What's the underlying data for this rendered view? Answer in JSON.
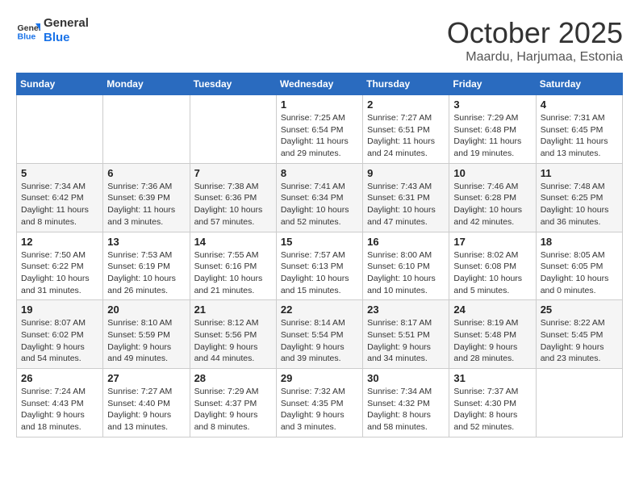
{
  "logo": {
    "line1": "General",
    "line2": "Blue"
  },
  "title": "October 2025",
  "location": "Maardu, Harjumaa, Estonia",
  "weekdays": [
    "Sunday",
    "Monday",
    "Tuesday",
    "Wednesday",
    "Thursday",
    "Friday",
    "Saturday"
  ],
  "weeks": [
    [
      null,
      null,
      null,
      {
        "day": 1,
        "sunrise": "7:25 AM",
        "sunset": "6:54 PM",
        "daylight": "11 hours and 29 minutes."
      },
      {
        "day": 2,
        "sunrise": "7:27 AM",
        "sunset": "6:51 PM",
        "daylight": "11 hours and 24 minutes."
      },
      {
        "day": 3,
        "sunrise": "7:29 AM",
        "sunset": "6:48 PM",
        "daylight": "11 hours and 19 minutes."
      },
      {
        "day": 4,
        "sunrise": "7:31 AM",
        "sunset": "6:45 PM",
        "daylight": "11 hours and 13 minutes."
      }
    ],
    [
      {
        "day": 5,
        "sunrise": "7:34 AM",
        "sunset": "6:42 PM",
        "daylight": "11 hours and 8 minutes."
      },
      {
        "day": 6,
        "sunrise": "7:36 AM",
        "sunset": "6:39 PM",
        "daylight": "11 hours and 3 minutes."
      },
      {
        "day": 7,
        "sunrise": "7:38 AM",
        "sunset": "6:36 PM",
        "daylight": "10 hours and 57 minutes."
      },
      {
        "day": 8,
        "sunrise": "7:41 AM",
        "sunset": "6:34 PM",
        "daylight": "10 hours and 52 minutes."
      },
      {
        "day": 9,
        "sunrise": "7:43 AM",
        "sunset": "6:31 PM",
        "daylight": "10 hours and 47 minutes."
      },
      {
        "day": 10,
        "sunrise": "7:46 AM",
        "sunset": "6:28 PM",
        "daylight": "10 hours and 42 minutes."
      },
      {
        "day": 11,
        "sunrise": "7:48 AM",
        "sunset": "6:25 PM",
        "daylight": "10 hours and 36 minutes."
      }
    ],
    [
      {
        "day": 12,
        "sunrise": "7:50 AM",
        "sunset": "6:22 PM",
        "daylight": "10 hours and 31 minutes."
      },
      {
        "day": 13,
        "sunrise": "7:53 AM",
        "sunset": "6:19 PM",
        "daylight": "10 hours and 26 minutes."
      },
      {
        "day": 14,
        "sunrise": "7:55 AM",
        "sunset": "6:16 PM",
        "daylight": "10 hours and 21 minutes."
      },
      {
        "day": 15,
        "sunrise": "7:57 AM",
        "sunset": "6:13 PM",
        "daylight": "10 hours and 15 minutes."
      },
      {
        "day": 16,
        "sunrise": "8:00 AM",
        "sunset": "6:10 PM",
        "daylight": "10 hours and 10 minutes."
      },
      {
        "day": 17,
        "sunrise": "8:02 AM",
        "sunset": "6:08 PM",
        "daylight": "10 hours and 5 minutes."
      },
      {
        "day": 18,
        "sunrise": "8:05 AM",
        "sunset": "6:05 PM",
        "daylight": "10 hours and 0 minutes."
      }
    ],
    [
      {
        "day": 19,
        "sunrise": "8:07 AM",
        "sunset": "6:02 PM",
        "daylight": "9 hours and 54 minutes."
      },
      {
        "day": 20,
        "sunrise": "8:10 AM",
        "sunset": "5:59 PM",
        "daylight": "9 hours and 49 minutes."
      },
      {
        "day": 21,
        "sunrise": "8:12 AM",
        "sunset": "5:56 PM",
        "daylight": "9 hours and 44 minutes."
      },
      {
        "day": 22,
        "sunrise": "8:14 AM",
        "sunset": "5:54 PM",
        "daylight": "9 hours and 39 minutes."
      },
      {
        "day": 23,
        "sunrise": "8:17 AM",
        "sunset": "5:51 PM",
        "daylight": "9 hours and 34 minutes."
      },
      {
        "day": 24,
        "sunrise": "8:19 AM",
        "sunset": "5:48 PM",
        "daylight": "9 hours and 28 minutes."
      },
      {
        "day": 25,
        "sunrise": "8:22 AM",
        "sunset": "5:45 PM",
        "daylight": "9 hours and 23 minutes."
      }
    ],
    [
      {
        "day": 26,
        "sunrise": "7:24 AM",
        "sunset": "4:43 PM",
        "daylight": "9 hours and 18 minutes."
      },
      {
        "day": 27,
        "sunrise": "7:27 AM",
        "sunset": "4:40 PM",
        "daylight": "9 hours and 13 minutes."
      },
      {
        "day": 28,
        "sunrise": "7:29 AM",
        "sunset": "4:37 PM",
        "daylight": "9 hours and 8 minutes."
      },
      {
        "day": 29,
        "sunrise": "7:32 AM",
        "sunset": "4:35 PM",
        "daylight": "9 hours and 3 minutes."
      },
      {
        "day": 30,
        "sunrise": "7:34 AM",
        "sunset": "4:32 PM",
        "daylight": "8 hours and 58 minutes."
      },
      {
        "day": 31,
        "sunrise": "7:37 AM",
        "sunset": "4:30 PM",
        "daylight": "8 hours and 52 minutes."
      },
      null
    ]
  ]
}
